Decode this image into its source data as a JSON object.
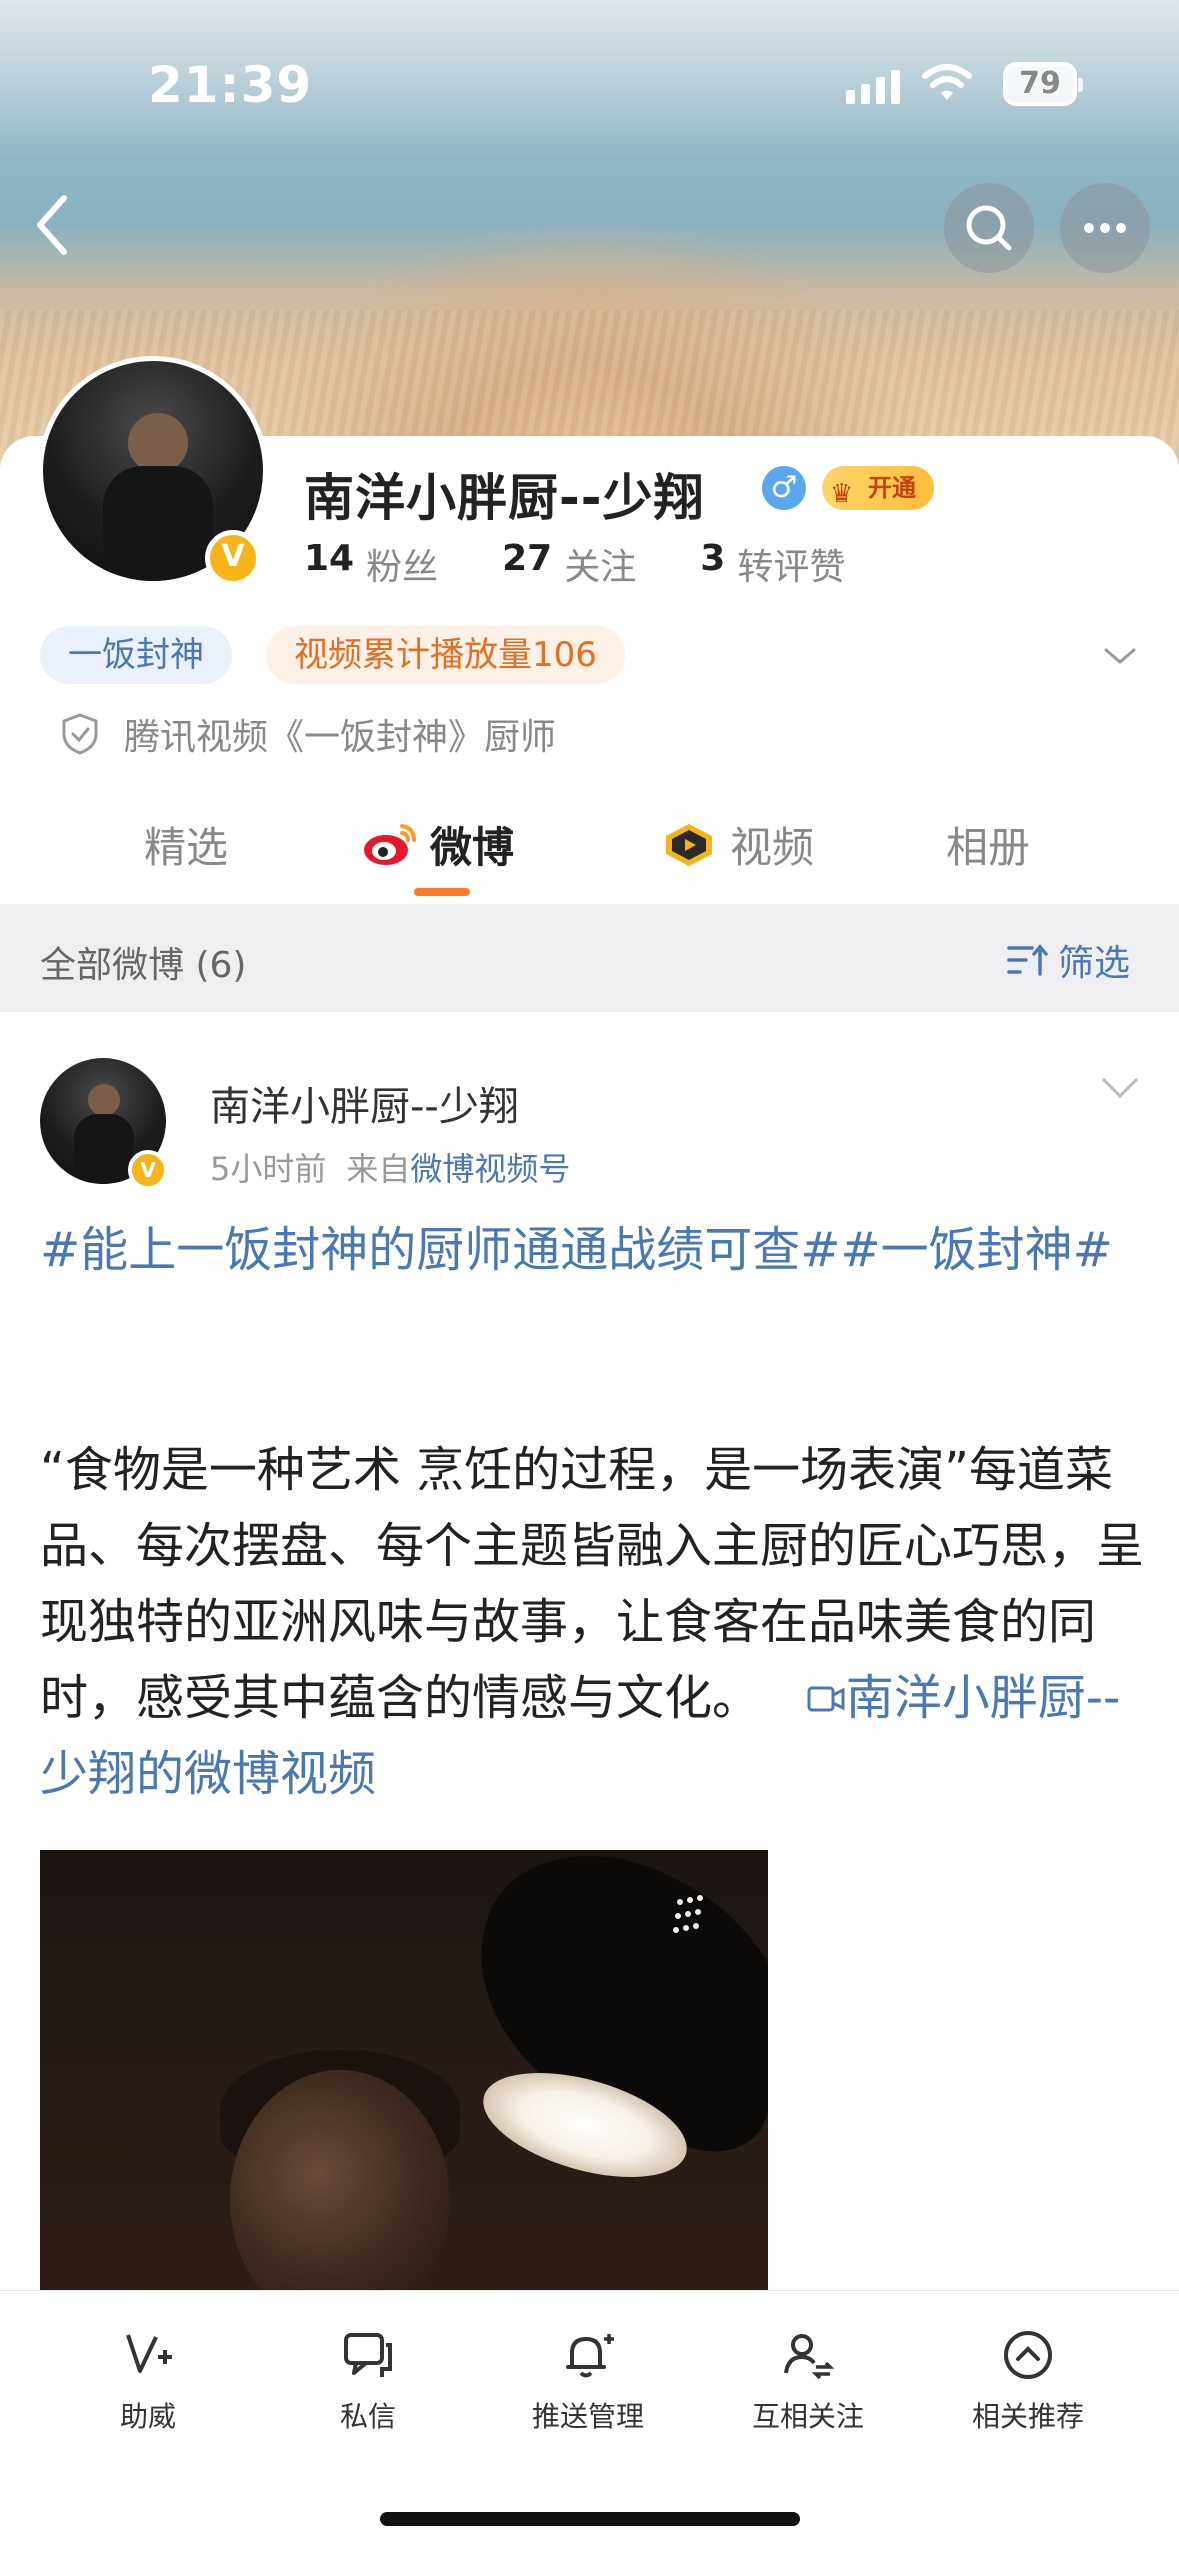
{
  "status_bar": {
    "time": "21:39",
    "battery": "79"
  },
  "profile": {
    "name": "南洋小胖厨--少翔",
    "vip_label": "开通",
    "stats": [
      {
        "count": "14",
        "label": "粉丝"
      },
      {
        "count": "27",
        "label": "关注"
      },
      {
        "count": "3",
        "label": "转评赞"
      }
    ],
    "tags": [
      "一饭封神",
      "视频累计播放量106"
    ],
    "certification": "腾讯视频《一饭封神》厨师"
  },
  "tabs": [
    {
      "label": "精选"
    },
    {
      "label": "微博"
    },
    {
      "label": "视频"
    },
    {
      "label": "相册"
    }
  ],
  "filter": {
    "title": "全部微博 (6)",
    "button": "筛选"
  },
  "post": {
    "author": "南洋小胖厨--少翔",
    "time": "5小时前",
    "source_prefix": "来自",
    "source": "微博视频号",
    "hashtags": "#能上一饭封神的厨师通通战绩可查##一饭封神#",
    "text": "“食物是一种艺术 烹饪的过程，是一场表演”每道菜品、每次摆盘、每个主题皆融入主厨的匠心巧思，呈现独特的亚洲风味与故事，让食客在品味美食的同时，感受其中蕴含的情感与文化。",
    "video_link": "南洋小胖厨--少翔的微博视频"
  },
  "bottom_bar": [
    {
      "label": "助威",
      "icon": "cheer-icon"
    },
    {
      "label": "私信",
      "icon": "message-icon"
    },
    {
      "label": "推送管理",
      "icon": "bell-icon"
    },
    {
      "label": "互相关注",
      "icon": "mutual-follow-icon"
    },
    {
      "label": "相关推荐",
      "icon": "recommend-icon"
    }
  ],
  "colors": {
    "link": "#4a78b5",
    "accent": "#ff7a2a",
    "vip": "#f6b418"
  }
}
